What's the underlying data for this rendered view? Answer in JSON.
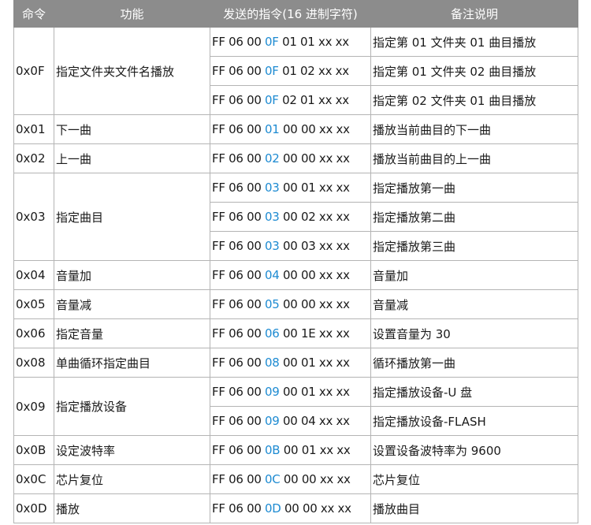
{
  "headers": [
    "命令",
    "功能",
    "发送的指令(16 进制字符)",
    "备注说明"
  ],
  "rows": [
    {
      "code": "0x0F",
      "func": "指定文件夹文件名播放",
      "entries": [
        {
          "pre": "FF 06 00 ",
          "hl": "0F",
          "post": " 01 01 xx xx",
          "note": "指定第 01 文件夹 01 曲目播放"
        },
        {
          "pre": "FF 06 00 ",
          "hl": "0F",
          "post": " 01 02 xx xx",
          "note": "指定第 01 文件夹 02 曲目播放"
        },
        {
          "pre": "FF 06 00 ",
          "hl": "0F",
          "post": " 02 01 xx xx",
          "note": "指定第 02 文件夹 01 曲目播放"
        }
      ]
    },
    {
      "code": "0x01",
      "func": "下一曲",
      "entries": [
        {
          "pre": "FF 06 00 ",
          "hl": "01",
          "post": " 00 00 xx xx",
          "note": "播放当前曲目的下一曲"
        }
      ]
    },
    {
      "code": "0x02",
      "func": "上一曲",
      "entries": [
        {
          "pre": "FF 06 00 ",
          "hl": "02",
          "post": " 00 00 xx xx",
          "note": "播放当前曲目的上一曲"
        }
      ]
    },
    {
      "code": "0x03",
      "func": "指定曲目",
      "entries": [
        {
          "pre": "FF 06 00 ",
          "hl": "03",
          "post": " 00 01 xx xx",
          "note": "指定播放第一曲"
        },
        {
          "pre": "FF 06 00 ",
          "hl": "03",
          "post": " 00 02 xx xx",
          "note": "指定播放第二曲"
        },
        {
          "pre": "FF 06 00 ",
          "hl": "03",
          "post": " 00 03 xx xx",
          "note": "指定播放第三曲"
        }
      ]
    },
    {
      "code": "0x04",
      "func": "音量加",
      "entries": [
        {
          "pre": "FF 06 00 ",
          "hl": "04",
          "post": " 00 00 xx xx",
          "note": "音量加"
        }
      ]
    },
    {
      "code": "0x05",
      "func": "音量减",
      "entries": [
        {
          "pre": "FF 06 00 ",
          "hl": "05",
          "post": " 00 00 xx xx",
          "note": "音量减"
        }
      ]
    },
    {
      "code": "0x06",
      "func": "指定音量",
      "entries": [
        {
          "pre": "FF 06 00 ",
          "hl": "06",
          "post": " 00 1E xx xx",
          "note": "设置音量为 30"
        }
      ]
    },
    {
      "code": "0x08",
      "func": "单曲循环指定曲目",
      "entries": [
        {
          "pre": "FF 06 00 ",
          "hl": "08",
          "post": " 00 01 xx xx",
          "note": "循环播放第一曲"
        }
      ]
    },
    {
      "code": "0x09",
      "func": "指定播放设备",
      "entries": [
        {
          "pre": "FF 06 00 ",
          "hl": "09",
          "post": " 00 01 xx xx",
          "note": "指定播放设备-U 盘"
        },
        {
          "pre": "FF 06 00 ",
          "hl": "09",
          "post": " 00 04 xx xx",
          "note": "指定播放设备-FLASH"
        }
      ]
    },
    {
      "code": "0x0B",
      "func": "设定波特率",
      "entries": [
        {
          "pre": "FF 06 00 ",
          "hl": "0B",
          "post": " 00 01 xx xx",
          "note": "设置设备波特率为 9600"
        }
      ]
    },
    {
      "code": "0x0C",
      "func": "芯片复位",
      "entries": [
        {
          "pre": "FF 06 00 ",
          "hl": "0C",
          "post": " 00 00 xx xx",
          "note": "芯片复位"
        }
      ]
    },
    {
      "code": "0x0D",
      "func": "播放",
      "entries": [
        {
          "pre": "FF 06 00 ",
          "hl": "0D",
          "post": " 00 00 xx xx",
          "note": "播放曲目"
        }
      ]
    }
  ],
  "colors": {
    "header_bg": "#8c8c8c",
    "highlight": "#1e8bd2",
    "border": "#b4b4b4"
  }
}
